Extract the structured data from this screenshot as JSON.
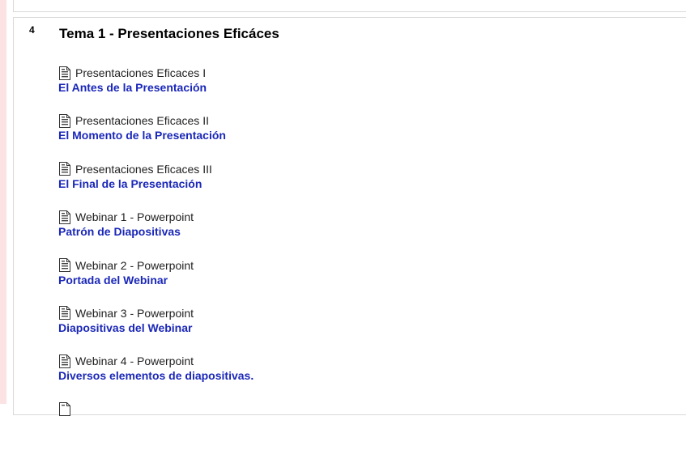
{
  "section": {
    "number": "4",
    "title": "Tema 1 - Presentaciones Eficáces"
  },
  "activities": [
    {
      "name": "Presentaciones Eficaces I",
      "link": "El Antes de la Presentación",
      "icon": "document-icon"
    },
    {
      "name": "Presentaciones Eficaces II",
      "link": "El Momento de la Presentación",
      "icon": "document-icon"
    },
    {
      "name": "Presentaciones Eficaces III",
      "link": "El Final de la Presentación",
      "icon": "document-icon"
    },
    {
      "name": "Webinar 1 - Powerpoint",
      "link": "Patrón de Diapositivas",
      "icon": "document-icon"
    },
    {
      "name": "Webinar 2 - Powerpoint",
      "link": "Portada del Webinar",
      "icon": "document-icon"
    },
    {
      "name": "Webinar 3 - Powerpoint",
      "link": "Diapositivas del Webinar",
      "icon": "document-icon"
    },
    {
      "name": "Webinar 4 - Powerpoint",
      "link": "Diversos elementos de diapositivas.",
      "icon": "document-icon"
    }
  ],
  "colors": {
    "link": "#1a27b8",
    "border": "#d9d9d9",
    "left_strip": "#fbe3e3"
  }
}
